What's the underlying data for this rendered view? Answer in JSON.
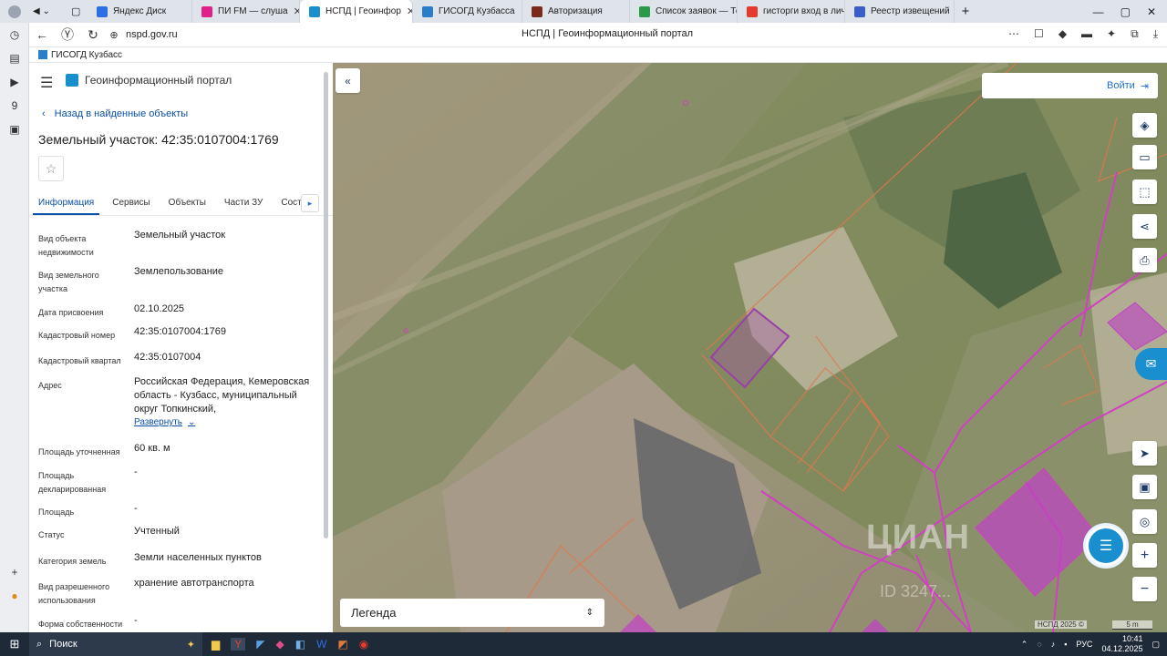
{
  "browser": {
    "tabs": [
      {
        "label": "Яндекс Диск",
        "fav": "#2b6fe0"
      },
      {
        "label": "ПИ FM — слуша",
        "fav": "#e0218a"
      },
      {
        "label": "НСПД | Геоинфор",
        "fav": "#1a8fd0",
        "active": true
      },
      {
        "label": "ГИСОГД Кузбасса",
        "fav": "#2a7dc9"
      },
      {
        "label": "Авторизация",
        "fav": "#7a2a1a"
      },
      {
        "label": "Список заявок — Тех",
        "fav": "#2a9a4a"
      },
      {
        "label": "гисторги вход в личн",
        "fav": "#e53b2c"
      },
      {
        "label": "Реестр извещений",
        "fav": "#3a5ec9"
      }
    ],
    "url": "nspd.gov.ru",
    "page_title": "НСПД | Геоинформационный портал",
    "bookmark": "ГИСОГД Кузбасс"
  },
  "panel": {
    "app_title": "Геоинформационный портал",
    "back_link": "Назад в найденные объекты",
    "heading": "Земельный участок: 42:35:0107004:1769",
    "tabs": [
      "Информация",
      "Сервисы",
      "Объекты",
      "Части ЗУ",
      "Соста"
    ],
    "fields": [
      {
        "label": "Вид объекта недвижимости",
        "value": "Земельный участок"
      },
      {
        "label": "Вид земельного участка",
        "value": "Землепользование"
      },
      {
        "label": "Дата присвоения",
        "value": "02.10.2025"
      },
      {
        "label": "Кадастровый номер",
        "value": "42:35:0107004:1769"
      },
      {
        "label": "Кадастровый квартал",
        "value": "42:35:0107004"
      },
      {
        "label": "Адрес",
        "value": "Российская Федерация, Кемеровская область - Кузбасс, муниципальный округ Топкинский,"
      },
      {
        "label": "Площадь уточненная",
        "value": "60 кв. м"
      },
      {
        "label": "Площадь декларированная",
        "value": "-"
      },
      {
        "label": "Площадь",
        "value": "-"
      },
      {
        "label": "Статус",
        "value": "Учтенный"
      },
      {
        "label": "Категория земель",
        "value": "Земли населенных пунктов"
      },
      {
        "label": "Вид разрешенного использования",
        "value": "хранение автотранспорта"
      },
      {
        "label": "Форма собственности",
        "value": "-"
      }
    ],
    "expand_link": "Развернуть"
  },
  "map": {
    "login": "Войти",
    "legend": "Легенда",
    "copyright": "НСПД 2025 ©",
    "scale": "5 m",
    "watermark": "ЦИАН",
    "watermark_id": "ID 3247..."
  },
  "taskbar": {
    "search": "Поиск",
    "lang": "РУС",
    "time": "10:41",
    "date": "04.12.2025"
  }
}
